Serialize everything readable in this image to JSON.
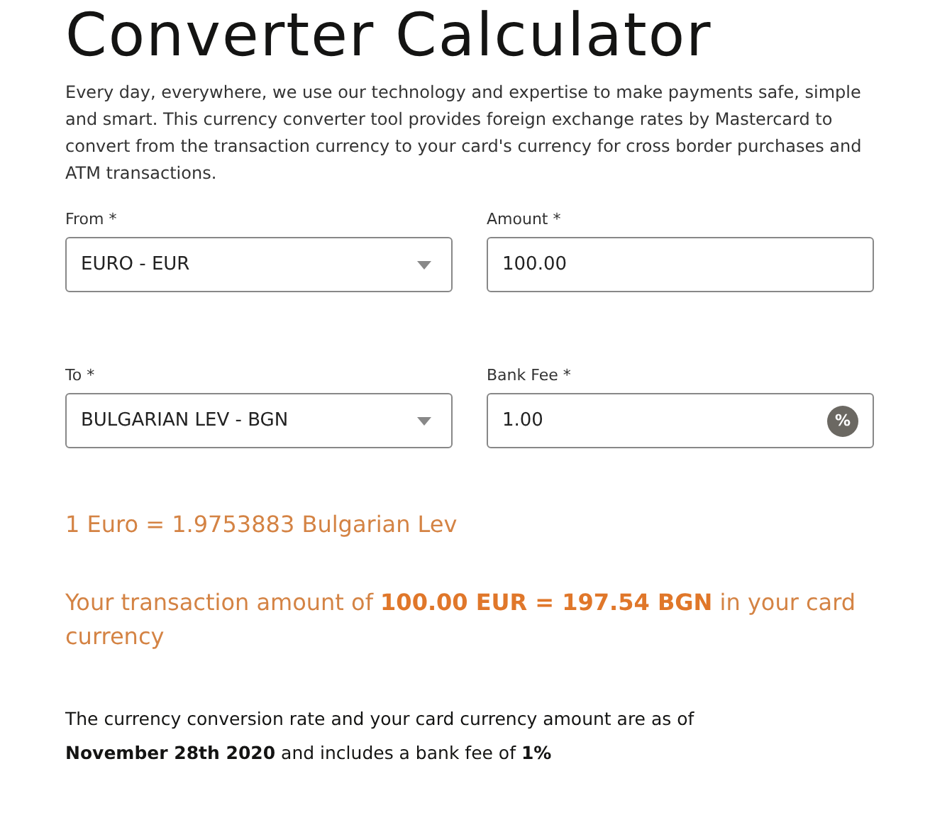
{
  "title": "Converter Calculator",
  "intro": "Every day, everywhere, we use our technology and expertise to make payments safe, simple and smart. This currency converter tool provides foreign exchange rates by Mastercard to convert from the transaction currency to your card's currency for cross border purchases and ATM transactions.",
  "fields": [
    {
      "kind": "select",
      "label": "From *",
      "value": "EURO - EUR"
    },
    {
      "kind": "input",
      "label": "Amount *",
      "value": "100.00"
    },
    {
      "kind": "select",
      "label": "To *",
      "value": "BULGARIAN LEV - BGN"
    },
    {
      "kind": "percent",
      "label": "Bank Fee *",
      "value": "1.00",
      "suffix": "%"
    }
  ],
  "rate": "1 Euro = 1.9753883 Bulgarian Lev",
  "result": "Your transaction amount of **100.00 EUR = 197.54 BGN** in your card currency",
  "note": "The currency conversion rate and your card currency amount are as of **November 28th 2020** and includes a bank fee of **1%**"
}
